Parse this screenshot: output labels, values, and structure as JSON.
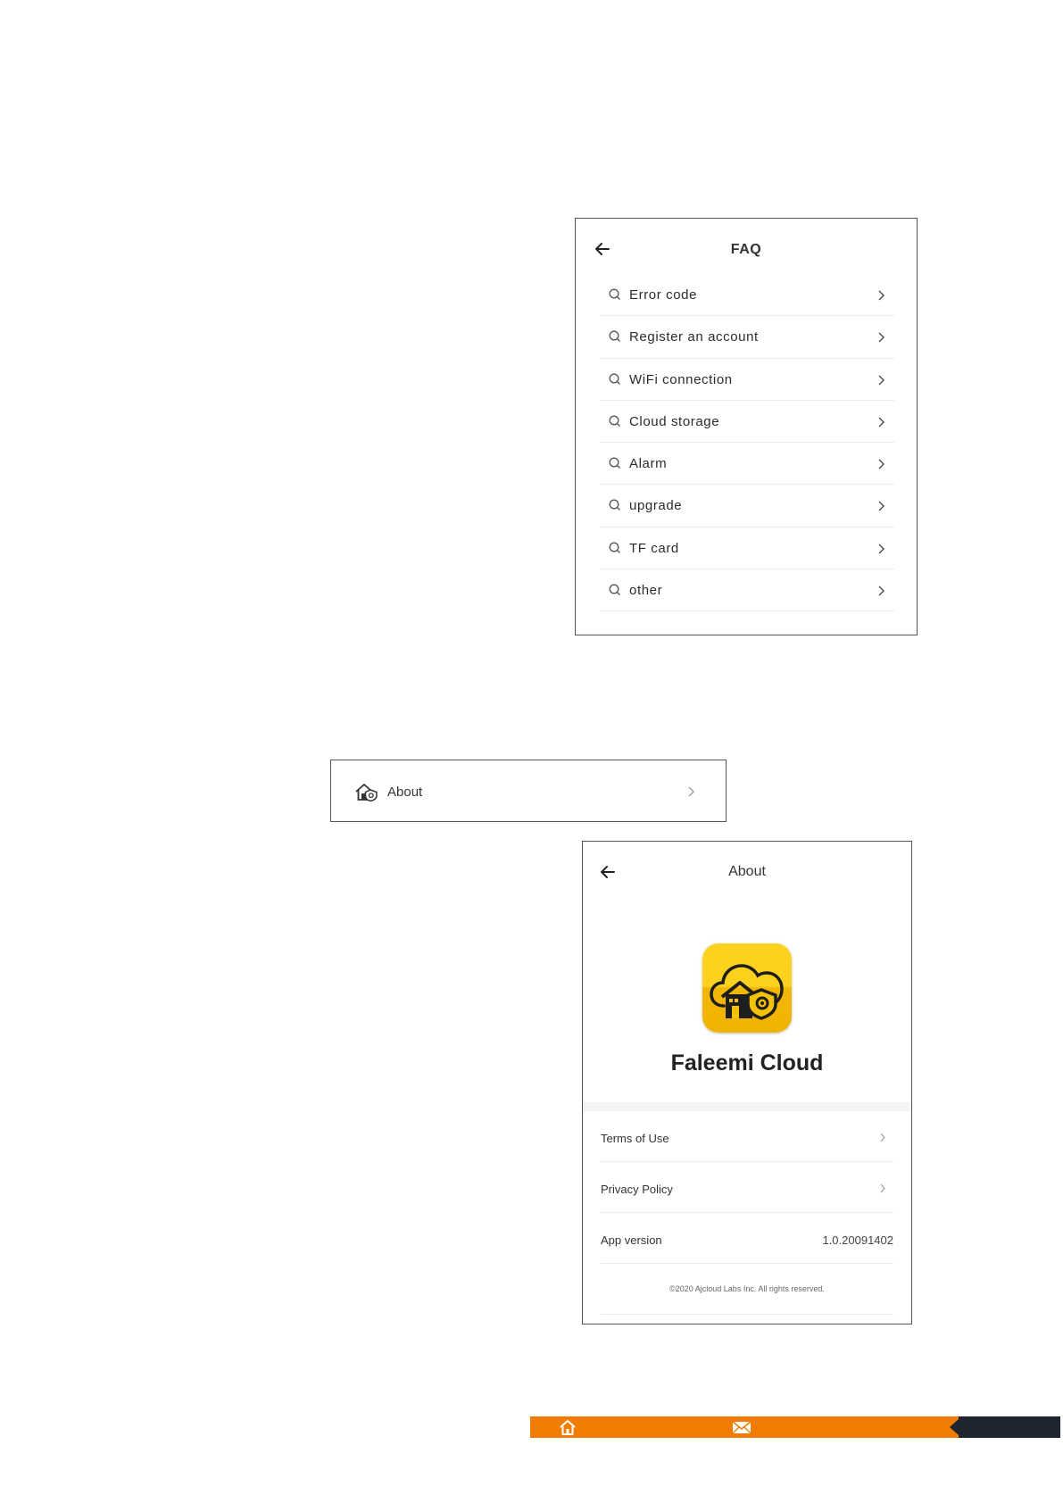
{
  "faq": {
    "title": "FAQ",
    "items": [
      {
        "label": "Error code"
      },
      {
        "label": "Register an account"
      },
      {
        "label": "WiFi connection"
      },
      {
        "label": "Cloud storage"
      },
      {
        "label": "Alarm"
      },
      {
        "label": "upgrade"
      },
      {
        "label": "TF card"
      },
      {
        "label": "other"
      }
    ]
  },
  "about_row": {
    "label": "About"
  },
  "about": {
    "title": "About",
    "app_name": "Faleemi Cloud",
    "items": [
      {
        "label": "Terms of Use"
      },
      {
        "label": "Privacy Policy"
      },
      {
        "label": "App version",
        "value": "1.0.20091402"
      }
    ],
    "copyright": "©2020 Ajcloud Labs Inc. All rights reserved."
  },
  "colors": {
    "footer_accent": "#f07d00",
    "footer_dark": "#1e2430",
    "app_icon_yellow": "#fcd21e"
  },
  "icons": {
    "faq_item": "search-icon",
    "row_chevron": "chevron-right-icon",
    "back": "arrow-left-icon",
    "about_row": "house-shield-icon",
    "footer_home": "home-icon",
    "footer_mail": "mail-icon"
  }
}
